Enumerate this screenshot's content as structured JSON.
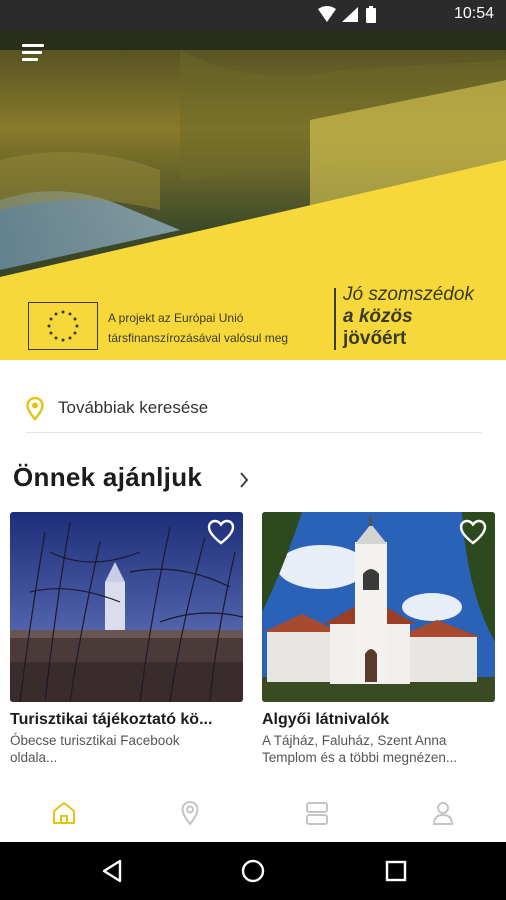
{
  "status_bar": {
    "time": "10:54"
  },
  "hero": {
    "eu_text_line1": "A projekt az Európai Unió",
    "eu_text_line2": "társfinanszírozásával valósul meg",
    "slogan_line1": "Jó szomszédok",
    "slogan_line2": "a közös",
    "slogan_line3": "jövőért"
  },
  "search": {
    "placeholder": "Továbbiak keresése"
  },
  "section": {
    "title": "Önnek ajánljuk"
  },
  "cards": [
    {
      "title": "Turisztikai tájékoztató kö...",
      "desc_line1": "Óbecse turisztikai Facebook",
      "desc_line2": "oldala..."
    },
    {
      "title": "Algyői látnivalók",
      "desc_line1": "A Tájház, Faluház, Szent Anna",
      "desc_line2": "Templom és a többi megnézen..."
    }
  ],
  "colors": {
    "accent": "#f5d53a",
    "active_tab": "#e6c312",
    "inactive_tab": "#c4c4c4"
  },
  "tabs": [
    {
      "icon": "home-icon",
      "active": true
    },
    {
      "icon": "map-pin-icon",
      "active": false
    },
    {
      "icon": "list-icon",
      "active": false
    },
    {
      "icon": "user-icon",
      "active": false
    }
  ]
}
